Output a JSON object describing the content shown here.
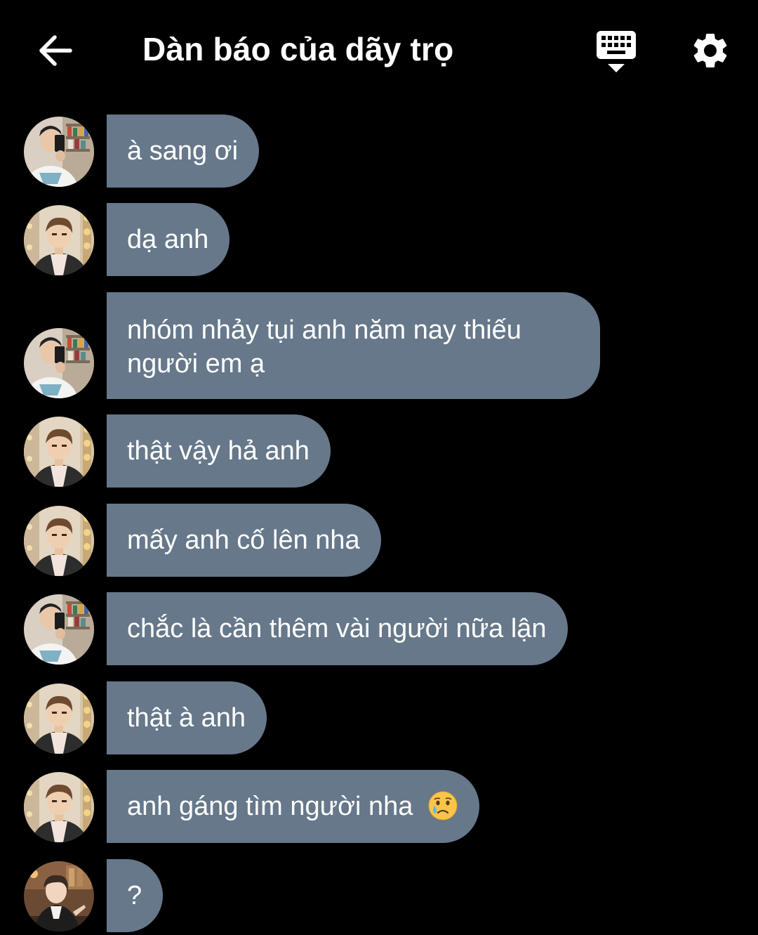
{
  "header": {
    "title": "Dàn báo của dãy trọ",
    "back_icon": "arrow-left-icon",
    "keyboard_icon": "keyboard-hide-icon",
    "settings_icon": "gear-icon"
  },
  "colors": {
    "background": "#000000",
    "bubble": "#66788a",
    "text": "#ffffff"
  },
  "messages": [
    {
      "sender": "user-a",
      "text": "à sang ơi"
    },
    {
      "sender": "user-b",
      "text": "dạ anh"
    },
    {
      "sender": "user-a",
      "text": "nhóm nhảy tụi anh năm nay thiếu người em ạ"
    },
    {
      "sender": "user-b",
      "text": "thật vậy hả anh"
    },
    {
      "sender": "user-b",
      "text": "mấy anh cố lên nha"
    },
    {
      "sender": "user-a",
      "text": "chắc là cần thêm vài người nữa lận"
    },
    {
      "sender": "user-b",
      "text": "thật à anh"
    },
    {
      "sender": "user-b",
      "text": "anh gáng tìm người nha",
      "emoji": "crying-face-emoji"
    },
    {
      "sender": "user-c",
      "text": "?"
    }
  ]
}
